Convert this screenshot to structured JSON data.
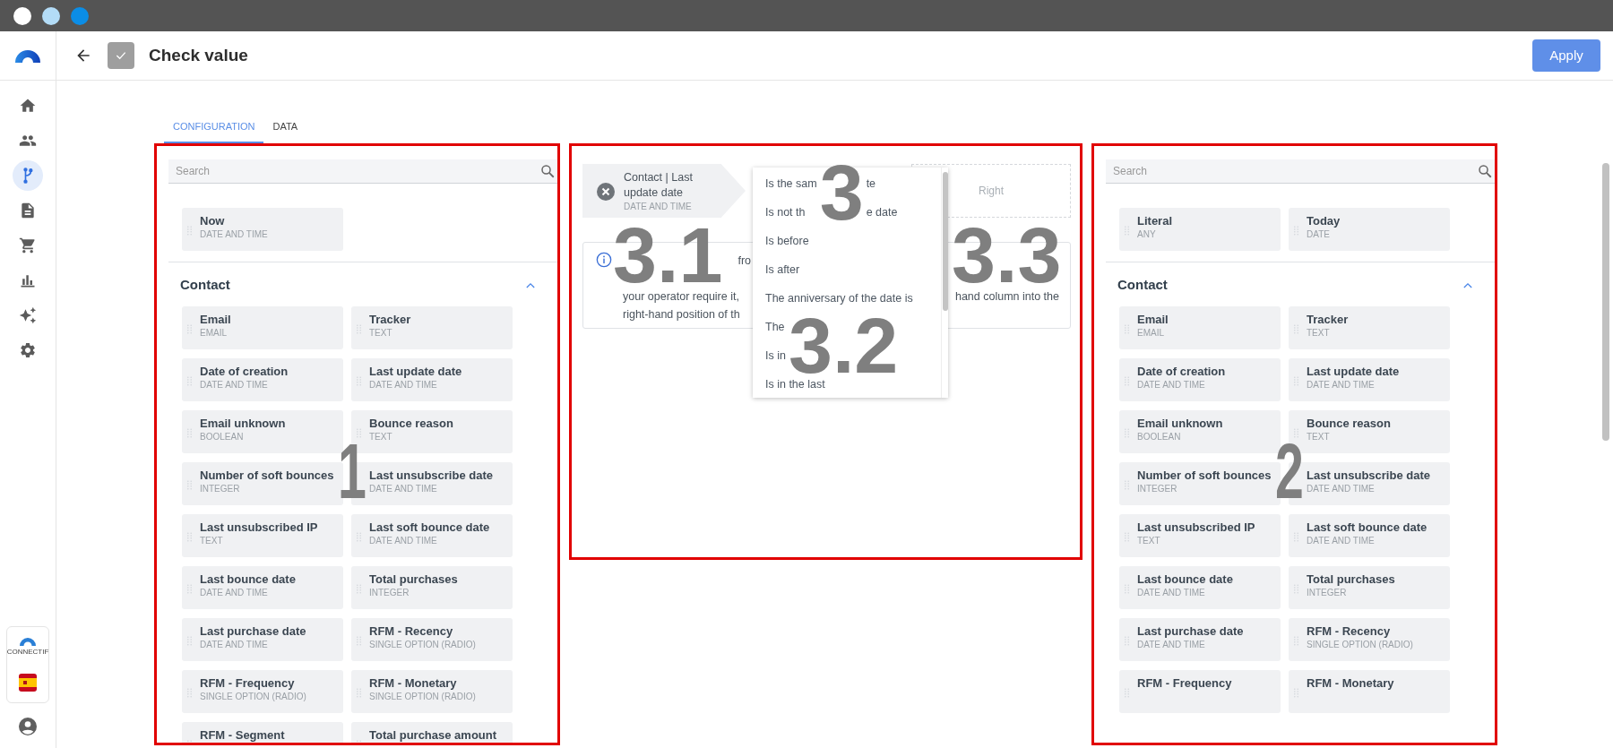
{
  "window_controls": [
    {
      "color": "#ffffff"
    },
    {
      "color": "#b3dcf7"
    },
    {
      "color": "#0b8de6"
    }
  ],
  "header": {
    "title": "Check value",
    "apply_button": "Apply"
  },
  "sidebar": {
    "brand_caption": "CONNECTIF",
    "items": [
      {
        "kind": "home",
        "selected": false
      },
      {
        "kind": "people",
        "selected": false
      },
      {
        "kind": "branch",
        "selected": true
      },
      {
        "kind": "document",
        "selected": false
      },
      {
        "kind": "cart",
        "selected": false
      },
      {
        "kind": "chart",
        "selected": false
      },
      {
        "kind": "sparkle",
        "selected": false
      },
      {
        "kind": "gear",
        "selected": false
      }
    ]
  },
  "tabs": [
    {
      "label": "CONFIGURATION",
      "selected": true
    },
    {
      "label": "DATA",
      "selected": false
    }
  ],
  "left_panel": {
    "annotation": "1",
    "search": {
      "placeholder": "Search"
    },
    "top_fields": [
      {
        "name": "Now",
        "type": "DATE AND TIME"
      }
    ],
    "section": {
      "title": "Contact",
      "expanded": true,
      "fields": [
        {
          "name": "Email",
          "type": "EMAIL"
        },
        {
          "name": "Tracker",
          "type": "TEXT"
        },
        {
          "name": "Date of creation",
          "type": "DATE AND TIME"
        },
        {
          "name": "Last update date",
          "type": "DATE AND TIME"
        },
        {
          "name": "Email unknown",
          "type": "BOOLEAN"
        },
        {
          "name": "Bounce reason",
          "type": "TEXT"
        },
        {
          "name": "Number of soft bounces",
          "type": "INTEGER"
        },
        {
          "name": "Last unsubscribe date",
          "type": "DATE AND TIME"
        },
        {
          "name": "Last unsubscribed IP",
          "type": "TEXT"
        },
        {
          "name": "Last soft bounce date",
          "type": "DATE AND TIME"
        },
        {
          "name": "Last bounce date",
          "type": "DATE AND TIME"
        },
        {
          "name": "Total purchases",
          "type": "INTEGER"
        },
        {
          "name": "Last purchase date",
          "type": "DATE AND TIME"
        },
        {
          "name": "RFM - Recency",
          "type": "SINGLE OPTION (RADIO)"
        },
        {
          "name": "RFM - Frequency",
          "type": "SINGLE OPTION (RADIO)"
        },
        {
          "name": "RFM - Monetary",
          "type": "SINGLE OPTION (RADIO)"
        },
        {
          "name": "RFM - Segment"
        },
        {
          "name": "Total purchase amount"
        }
      ]
    }
  },
  "condition_panel": {
    "annotations": [
      "3",
      "3.1",
      "3.2",
      "3.3"
    ],
    "left_operand": {
      "name": "Contact | Last update date",
      "type": "DATE AND TIME"
    },
    "right_placeholder": "Right",
    "info_left": [
      {
        "kind": "tail",
        "text": "fro"
      },
      {
        "kind": "line",
        "text": "your operator require it,"
      },
      {
        "kind": "line",
        "text": "right-hand position of th"
      }
    ],
    "info_right": [
      "hand column into the"
    ],
    "operator_menu": [
      {
        "parts": [
          "Is the sam",
          "te"
        ]
      },
      {
        "parts": [
          "Is not th",
          "e date"
        ]
      },
      {
        "parts": [
          "Is before"
        ]
      },
      {
        "parts": [
          "Is after"
        ]
      },
      {
        "parts": [
          "The anniversary of the date is"
        ]
      },
      {
        "parts": [
          "The"
        ]
      },
      {
        "parts": [
          "Is in"
        ]
      },
      {
        "parts": [
          "Is in the last"
        ]
      }
    ]
  },
  "right_panel": {
    "annotation": "2",
    "search": {
      "placeholder": "Search"
    },
    "top_fields": [
      {
        "name": "Literal",
        "type": "ANY"
      },
      {
        "name": "Today",
        "type": "DATE"
      }
    ],
    "section": {
      "title": "Contact",
      "expanded": true,
      "fields": [
        {
          "name": "Email",
          "type": "EMAIL"
        },
        {
          "name": "Tracker",
          "type": "TEXT"
        },
        {
          "name": "Date of creation",
          "type": "DATE AND TIME"
        },
        {
          "name": "Last update date",
          "type": "DATE AND TIME"
        },
        {
          "name": "Email unknown",
          "type": "BOOLEAN"
        },
        {
          "name": "Bounce reason",
          "type": "TEXT"
        },
        {
          "name": "Number of soft bounces",
          "type": "INTEGER"
        },
        {
          "name": "Last unsubscribe date",
          "type": "DATE AND TIME"
        },
        {
          "name": "Last unsubscribed IP",
          "type": "TEXT"
        },
        {
          "name": "Last soft bounce date",
          "type": "DATE AND TIME"
        },
        {
          "name": "Last bounce date",
          "type": "DATE AND TIME"
        },
        {
          "name": "Total purchases",
          "type": "INTEGER"
        },
        {
          "name": "Last purchase date",
          "type": "DATE AND TIME"
        },
        {
          "name": "RFM - Recency",
          "type": "SINGLE OPTION (RADIO)"
        },
        {
          "name": "RFM - Frequency"
        },
        {
          "name": "RFM - Monetary"
        }
      ]
    }
  }
}
